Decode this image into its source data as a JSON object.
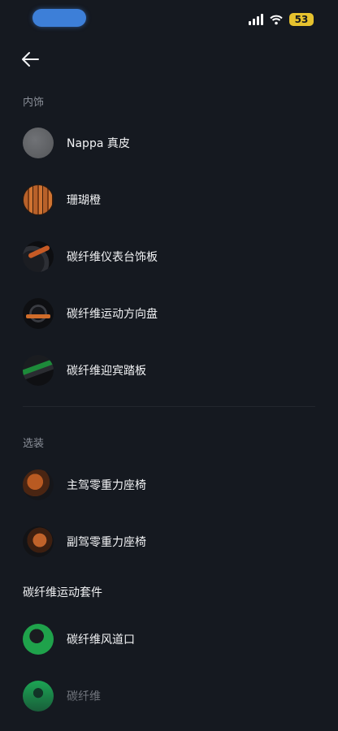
{
  "status": {
    "battery": "53"
  },
  "sections": {
    "interior_label": "内饰",
    "options_label": "选装",
    "carbon_kit_title": "碳纤维运动套件"
  },
  "interior_items": [
    {
      "label": "Nappa 真皮",
      "thumb": "gray-leather-swatch"
    },
    {
      "label": "珊瑚橙",
      "thumb": "coral-orange-swatch"
    },
    {
      "label": "碳纤维仪表台饰板",
      "thumb": "carbon-dashboard-trim"
    },
    {
      "label": "碳纤维运动方向盘",
      "thumb": "carbon-steering-wheel"
    },
    {
      "label": "碳纤维迎宾踏板",
      "thumb": "carbon-door-sill"
    }
  ],
  "option_items": [
    {
      "label": "主驾零重力座椅",
      "thumb": "driver-seat"
    },
    {
      "label": "副驾零重力座椅",
      "thumb": "passenger-seat"
    }
  ],
  "carbon_kit_items": [
    {
      "label": "碳纤维风道口",
      "thumb": "carbon-air-vent"
    },
    {
      "label": "碳纤维",
      "thumb": "carbon-kit-part"
    }
  ],
  "colors": {
    "background": "#151920",
    "accent_status": "#3d7fd8",
    "battery": "#e6c22e"
  }
}
